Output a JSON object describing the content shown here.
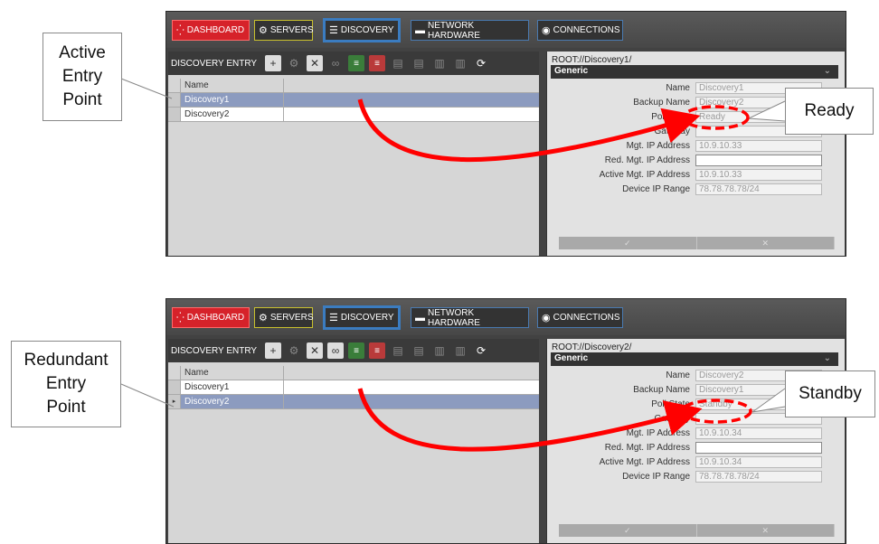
{
  "tabs": {
    "dashboard": "DASHBOARD",
    "servers": "SERVERS",
    "discovery": "DISCOVERY",
    "network": "NETWORK HARDWARE",
    "connections": "CONNECTIONS"
  },
  "toolbar_label": "DISCOVERY ENTRY",
  "grid_header": "Name",
  "fields": [
    "Name",
    "Backup Name",
    "Poll State",
    "Gateway",
    "Mgt. IP Address",
    "Red. Mgt. IP Address",
    "Active Mgt. IP Address",
    "Device IP Range"
  ],
  "section": "Generic",
  "panel1": {
    "path": "ROOT://Discovery1/",
    "rows": [
      "Discovery1",
      "Discovery2"
    ],
    "values": [
      "Discovery1",
      "Discovery2",
      "Ready",
      "",
      "10.9.10.33",
      "",
      "10.9.10.33",
      "78.78.78.78/24"
    ]
  },
  "panel2": {
    "path": "ROOT://Discovery2/",
    "rows": [
      "Discovery1",
      "Discovery2"
    ],
    "values": [
      "Discovery2",
      "Discovery1",
      "Standby",
      "",
      "10.9.10.34",
      "",
      "10.9.10.34",
      "78.78.78.78/24"
    ]
  },
  "callouts": {
    "active": [
      "Active",
      "Entry",
      "Point"
    ],
    "ready": "Ready",
    "redundant": [
      "Redundant",
      "Entry",
      "Point"
    ],
    "standby": "Standby"
  },
  "colors": {
    "selected_row": "#8c9bbf",
    "highlight": "#ff0000",
    "dashboard_tab": "#d6222a",
    "active_tab_border": "#3b7cc0"
  }
}
